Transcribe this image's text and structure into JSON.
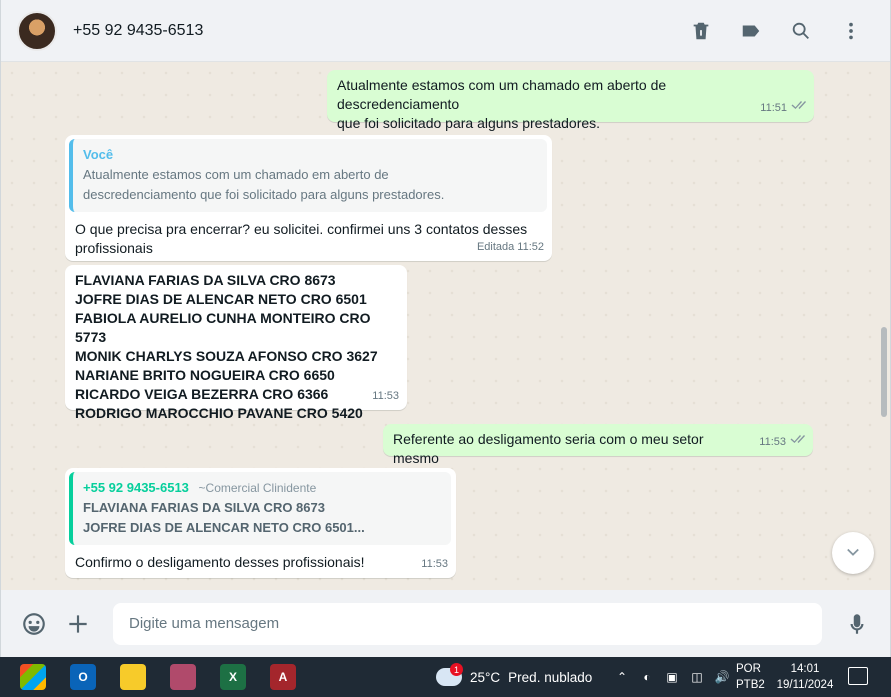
{
  "header": {
    "contact": "+55 92 9435-6513",
    "icons": [
      "delete-icon",
      "label-icon",
      "search-icon",
      "menu-icon"
    ]
  },
  "messages": [
    {
      "dir": "out",
      "text_lines": [
        "Atualmente estamos com um chamado em aberto de descredenciamento",
        "que foi solicitado para alguns prestadores."
      ],
      "time": "11:51"
    },
    {
      "dir": "in",
      "quote_author": "Você",
      "quote_lines": [
        "Atualmente estamos com um chamado em aberto de",
        "descredenciamento que foi solicitado para alguns prestadores."
      ],
      "text_lines": [
        "O que precisa pra encerrar? eu solicitei. confirmei uns 3 contatos desses",
        "profissionais"
      ],
      "edited": "Editada",
      "time": "11:52"
    },
    {
      "dir": "in",
      "list": [
        "FLAVIANA FARIAS DA SILVA CRO 8673",
        "JOFRE DIAS DE ALENCAR NETO CRO 6501",
        "FABIOLA AURELIO CUNHA MONTEIRO CRO 5773",
        "MONIK CHARLYS SOUZA AFONSO CRO 3627",
        "NARIANE BRITO NOGUEIRA CRO 6650",
        "RICARDO VEIGA BEZERRA CRO 6366",
        "RODRIGO MAROCCHIO PAVANE CRO 5420"
      ],
      "time": "11:53"
    },
    {
      "dir": "out",
      "text": "Referente ao desligamento seria com o meu setor mesmo",
      "time": "11:53"
    },
    {
      "dir": "in",
      "quote_author": "+55 92 9435-6513",
      "quote_sub": "~Comercial Clinidente",
      "quote_lines": [
        "FLAVIANA FARIAS DA SILVA CRO 8673",
        "JOFRE DIAS DE ALENCAR NETO CRO 6501..."
      ],
      "text": "Confirmo o desligamento desses profissionais!",
      "time": "11:53"
    }
  ],
  "composer": {
    "placeholder": "Digite uma mensagem"
  },
  "taskbar": {
    "weather_temp": "25°C",
    "weather_desc": "Pred. nublado",
    "weather_badge": "1",
    "lang_1": "POR",
    "lang_2": "PTB2",
    "time": "14:01",
    "date": "19/11/2024",
    "apps": [
      "start",
      "outlook",
      "sticky-notes",
      "snipping",
      "excel",
      "access"
    ]
  },
  "colors": {
    "outgoing": "#d9fdd3",
    "incoming": "#ffffff",
    "chat_bg": "#efeae2",
    "quote_blue": "#53bdeb",
    "quote_green": "#06cf9c"
  }
}
